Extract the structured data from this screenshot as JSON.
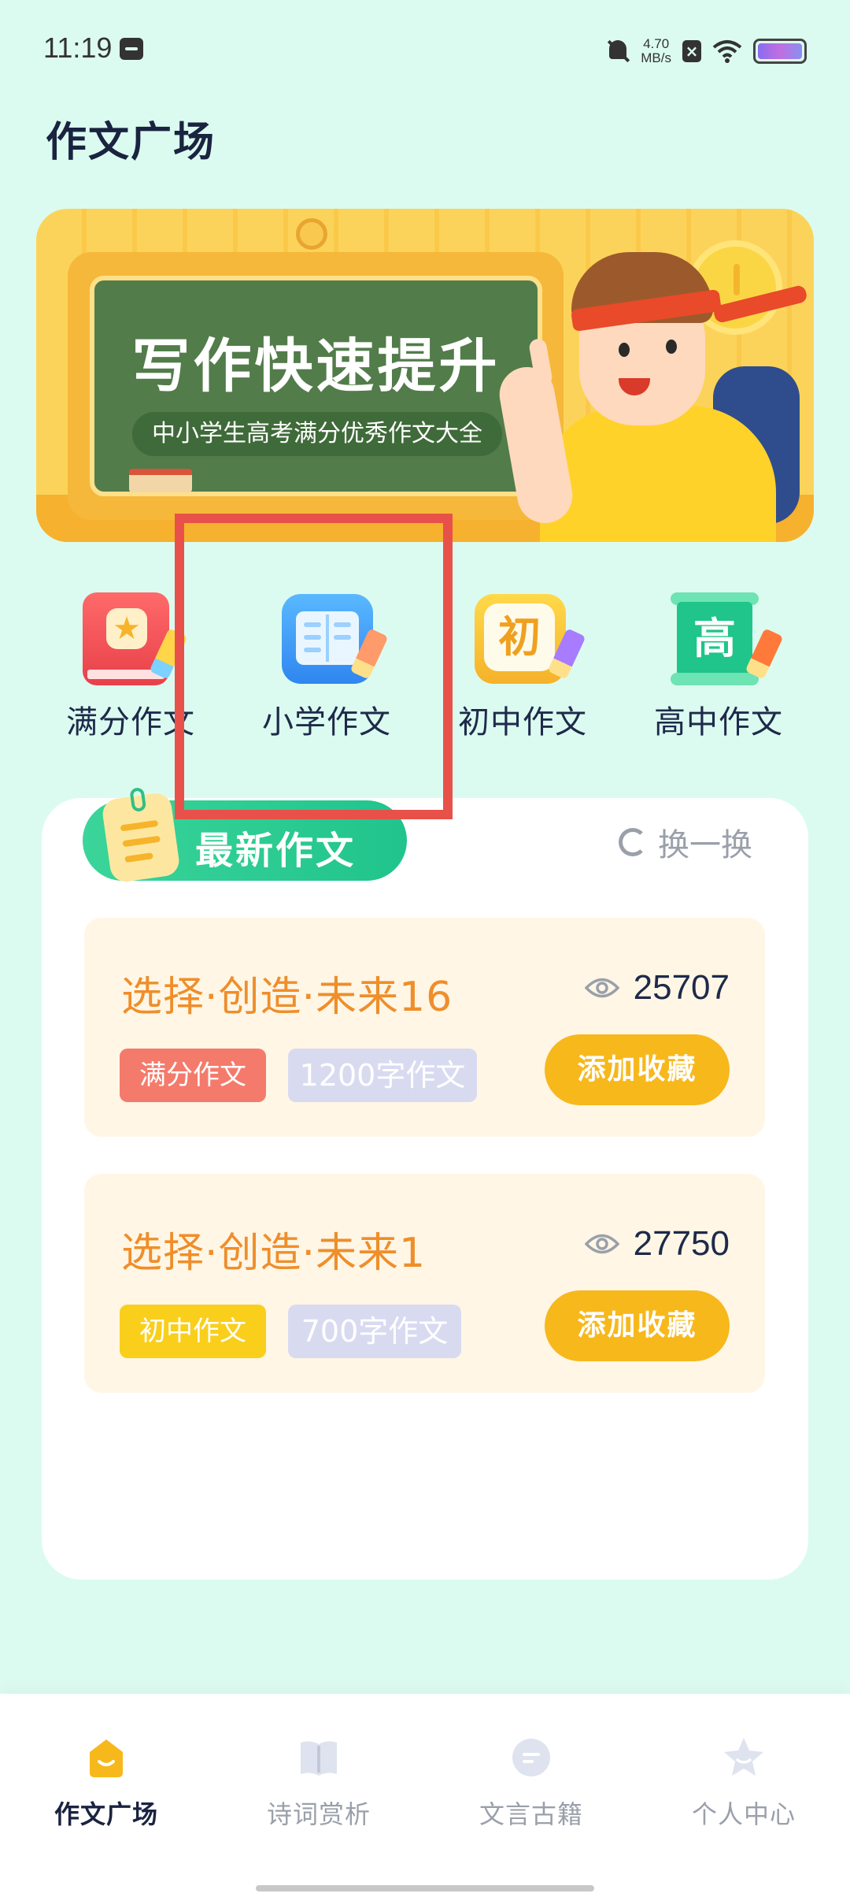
{
  "status_bar": {
    "time": "11:19",
    "net_speed_value": "4.70",
    "net_speed_unit": "MB/s"
  },
  "page_title": "作文广场",
  "banner": {
    "title": "写作快速提升",
    "subtitle": "中小学生高考满分优秀作文大全"
  },
  "categories": [
    {
      "label": "满分作文",
      "icon": "star-book-icon"
    },
    {
      "label": "小学作文",
      "icon": "open-book-icon"
    },
    {
      "label": "初中作文",
      "icon": "chu-icon",
      "glyph": "初"
    },
    {
      "label": "高中作文",
      "icon": "scroll-icon",
      "glyph": "高"
    }
  ],
  "latest": {
    "title": "最新作文",
    "refresh_label": "换一换",
    "essays": [
      {
        "title": "选择·创造·未来16",
        "views": "25707",
        "tag_level": "满分作文",
        "tag_length": "1200字作文",
        "fav_label": "添加收藏",
        "tag_color": "#f47b6c"
      },
      {
        "title": "选择·创造·未来1",
        "views": "27750",
        "tag_level": "初中作文",
        "tag_length": "700字作文",
        "fav_label": "添加收藏",
        "tag_color": "#f9cf1c"
      }
    ]
  },
  "nav": [
    {
      "label": "作文广场",
      "icon": "home-icon",
      "active": true
    },
    {
      "label": "诗词赏析",
      "icon": "book-icon",
      "active": false
    },
    {
      "label": "文言古籍",
      "icon": "chat-icon",
      "active": false
    },
    {
      "label": "个人中心",
      "icon": "star-icon",
      "active": false
    }
  ],
  "colors": {
    "background": "#dcfbf0",
    "accent_green": "#20c48c",
    "accent_yellow": "#f7b81c",
    "title_orange": "#ef8e2a",
    "highlight_red": "#e8514a"
  }
}
